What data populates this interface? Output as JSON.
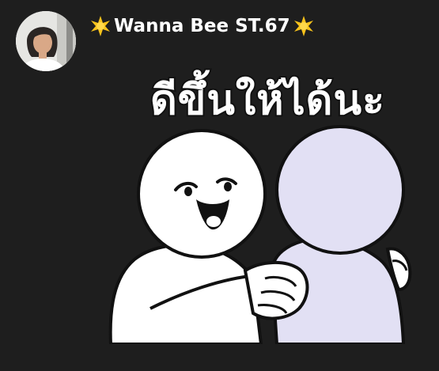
{
  "message": {
    "sender_name": "Wanna Bee ST.67",
    "sender_decoration_icon": "sun-star-icon",
    "sticker": {
      "text": "ดีขึ้นให้ได้นะ",
      "description_icon": "comforting-hug-sticker"
    }
  },
  "colors": {
    "background": "#1e1e1e",
    "sender_text": "#ffffff",
    "star": "#f7c21b",
    "character_left": "#ffffff",
    "character_right": "#e2e0f4",
    "outline": "#111111"
  }
}
